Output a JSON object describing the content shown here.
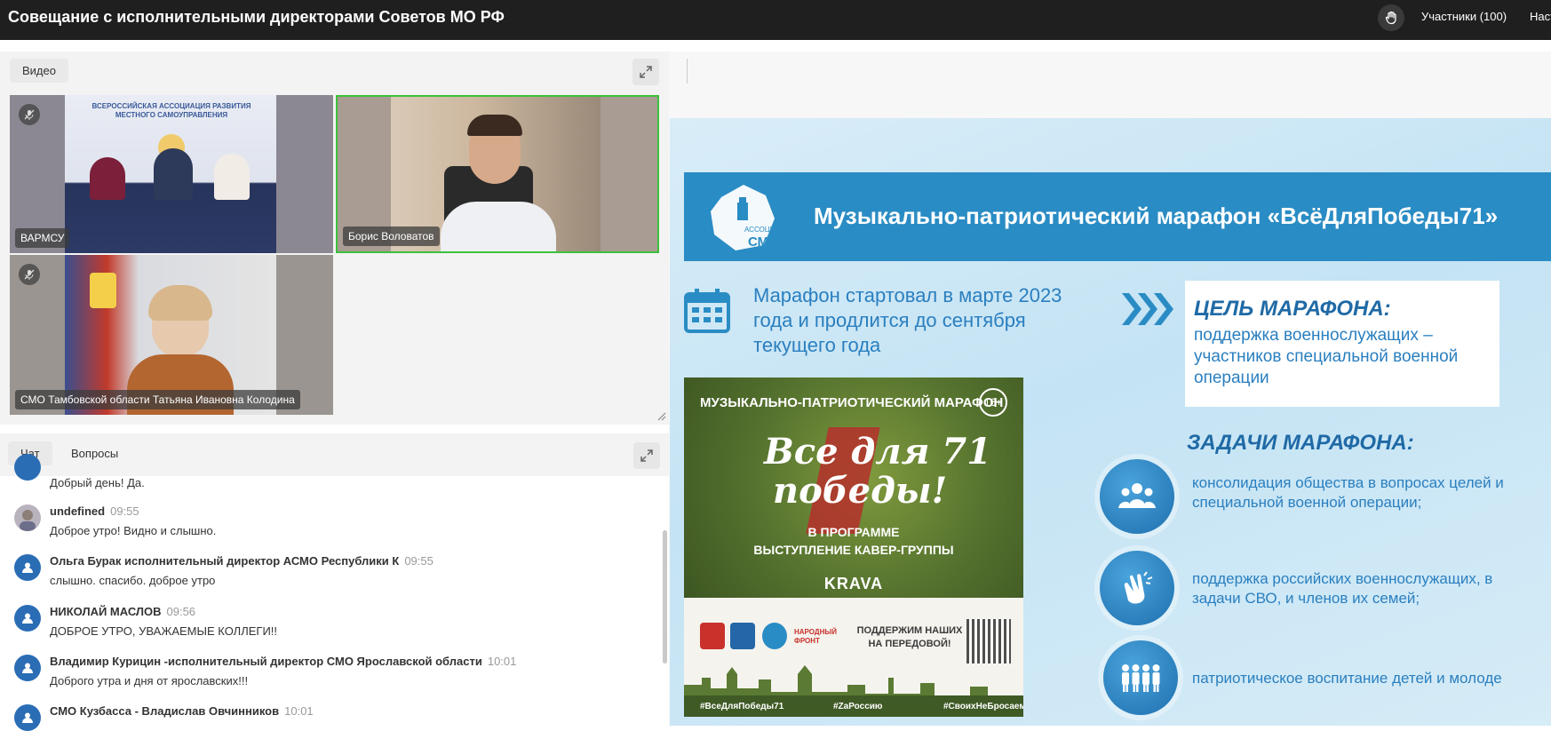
{
  "header": {
    "title": "Совещание с исполнительными директорами Советов МО РФ",
    "participants_label": "Участники (100)",
    "settings_label": "Наст"
  },
  "video_panel": {
    "tab_label": "Видео",
    "tiles": [
      {
        "name": "ВАРМСУ",
        "muted": true
      },
      {
        "name": "Борис Воловатов",
        "muted": false,
        "active_speaker": true
      },
      {
        "name": "СМО Тамбовской области Татьяна Ивановна Колодина",
        "muted": true
      }
    ],
    "backdrop_text": "ВСЕРОССИЙСКАЯ АССОЦИАЦИЯ РАЗВИТИЯ МЕСТНОГО САМОУПРАВЛЕНИЯ"
  },
  "chat_panel": {
    "tabs": [
      "Чат",
      "Вопросы"
    ],
    "messages": [
      {
        "author": "",
        "time": "",
        "text": "Добрый день! Да."
      },
      {
        "author": "undefined",
        "time": "09:55",
        "text": "Доброе утро! Видно и слышно."
      },
      {
        "author": "Ольга Бурак исполнительный директор АСМО Республики К",
        "time": "09:55",
        "text": "слышно. спасибо. доброе утро"
      },
      {
        "author": "НИКОЛАЙ МАСЛОВ",
        "time": "09:56",
        "text": "ДОБРОЕ УТРО, УВАЖАЕМЫЕ КОЛЛЕГИ!!"
      },
      {
        "author": "Владимир Курицин -исполнительный директор СМО Ярославской области",
        "time": "10:01",
        "text": "Доброго утра и дня от ярославских!!!"
      },
      {
        "author": "СМО Кузбасса - Владислав Овчинников",
        "time": "10:01",
        "text": ""
      }
    ]
  },
  "slide": {
    "logo_text": "СМО",
    "logo_sub": "АССОЦИАЦИЯ",
    "headline": "Музыкально-патриотический марафон «ВсёДляПобеды71»",
    "start_text": "Марафон стартовал в марте 2023 года и продлится до сентября текущего года",
    "goal_title": "ЦЕЛЬ МАРАФОНА:",
    "goal_text": "поддержка военнослужащих – участников специальной военной операции",
    "tasks_title": "ЗАДАЧИ МАРАФОНА:",
    "tasks": [
      {
        "text_line1": "консолидация общества в вопросах целей и",
        "text_line2": "специальной военной операции;",
        "icon": "people-icon"
      },
      {
        "text_line1": "поддержка российских военнослужащих, в",
        "text_line2": "задачи СВО, и членов их семей;",
        "icon": "clapping-hands-icon"
      },
      {
        "text_line1": "патриотическое воспитание детей и молоде",
        "text_line2": "",
        "icon": "children-icon"
      }
    ],
    "poster": {
      "title": "МУЗЫКАЛЬНО-ПАТРИОТИЧЕСКИЙ МАРАФОН",
      "age": "16+",
      "script_line1": "Все для 71",
      "script_line2": "победы!",
      "program_line1": "В ПРОГРАММЕ",
      "program_line2": "ВЫСТУПЛЕНИЕ КАВЕР-ГРУППЫ",
      "band": "KRAVA",
      "support": "ПОДДЕРЖИМ НАШИХ НА ПЕРЕДОВОЙ!",
      "front_label": "НАРОДНЫЙ ФРОНТ",
      "hashtags": [
        "#ВсеДляПобеды71",
        "#ZaРоссию",
        "#СвоихНеБросаем"
      ]
    }
  },
  "colors": {
    "topbar": "#1f1f1f",
    "banner": "#2a8cc4",
    "slide_text": "#2a7fbf",
    "slide_title": "#1f6aa6",
    "active_speaker_border": "#3cc13c",
    "avatar": "#2a6db5"
  }
}
